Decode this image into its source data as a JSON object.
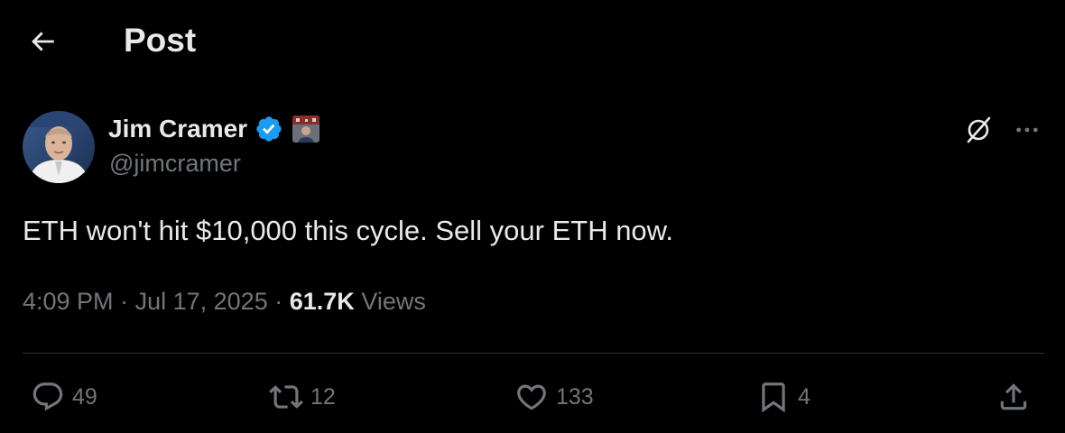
{
  "header": {
    "title": "Post"
  },
  "author": {
    "display_name": "Jim Cramer",
    "handle": "@jimcramer",
    "verified": true,
    "verified_color": "#1d9bf0"
  },
  "tweet": {
    "text": "ETH won't hit $10,000 this cycle. Sell your ETH now.",
    "time": "4:09 PM",
    "date": "Jul 17, 2025",
    "separator": "·",
    "views_count": "61.7K",
    "views_label": "Views"
  },
  "actions": {
    "replies": "49",
    "reposts": "12",
    "likes": "133",
    "bookmarks": "4"
  },
  "icons": [
    "back-arrow-icon",
    "verified-badge-icon",
    "affiliate-badge-icon",
    "grok-icon",
    "more-icon",
    "reply-icon",
    "repost-icon",
    "like-icon",
    "bookmark-icon",
    "share-icon"
  ],
  "colors": {
    "background": "#000000",
    "text": "#e7e9ea",
    "secondary": "#71767b",
    "divider": "#2f3336"
  }
}
